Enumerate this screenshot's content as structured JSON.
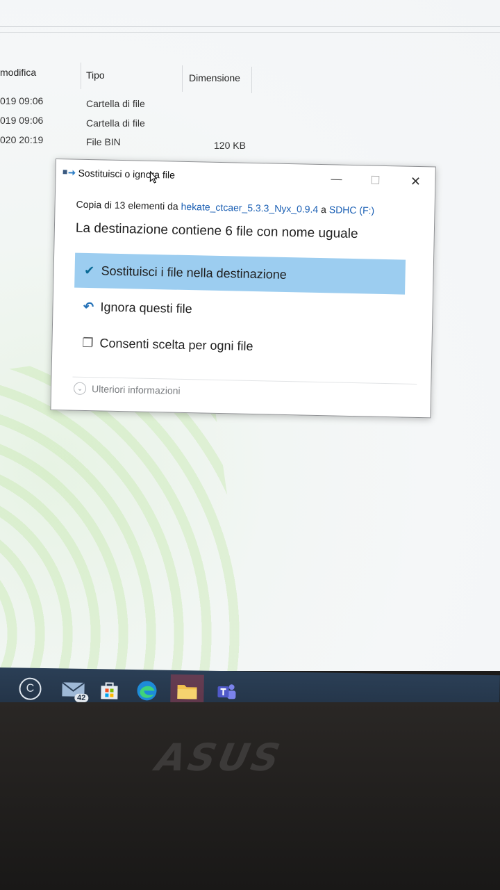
{
  "explorer": {
    "columns": [
      {
        "label": "modifica"
      },
      {
        "label": "Tipo"
      },
      {
        "label": "Dimensione"
      }
    ],
    "rows": [
      {
        "date": "019 09:06",
        "type": "Cartella di file",
        "size": ""
      },
      {
        "date": "019 09:06",
        "type": "Cartella di file",
        "size": ""
      },
      {
        "date": "020 20:19",
        "type": "File BIN",
        "size": "120 KB"
      }
    ]
  },
  "dialog": {
    "title": "Sostituisci o ignora file",
    "subtitle_prefix": "Copia di 13 elementi da ",
    "source": "hekate_ctcaer_5.3.3_Nyx_0.9.4",
    "subtitle_mid": " a ",
    "destination": "SDHC (F:)",
    "heading": "La destinazione contiene 6 file con nome uguale",
    "options": [
      {
        "label": "Sostituisci i file nella destinazione",
        "icon": "checkmark-icon",
        "selected": true
      },
      {
        "label": "Ignora questi file",
        "icon": "undo-icon",
        "selected": false
      },
      {
        "label": "Consenti scelta per ogni file",
        "icon": "copy-choose-icon",
        "selected": false
      }
    ],
    "more_info": "Ulteriori informazioni",
    "buttons": {
      "minimize": "—",
      "maximize": "☐",
      "close": "✕"
    }
  },
  "taskbar": {
    "mail_badge": "42",
    "items": [
      "cortana-icon",
      "mail-icon",
      "store-icon",
      "edge-icon",
      "file-explorer-icon",
      "teams-icon"
    ]
  },
  "bezel": {
    "logo_text": "ASUS"
  },
  "colors": {
    "selection": "#9ccdf0",
    "link": "#1a5fb4",
    "taskbar": "#223245"
  }
}
